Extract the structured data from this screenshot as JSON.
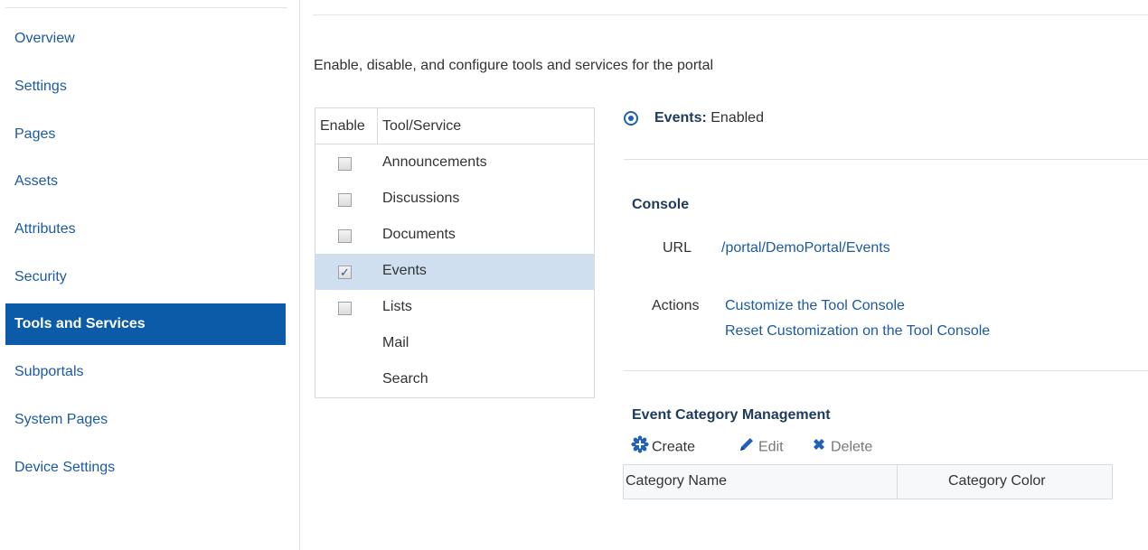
{
  "sidebar": {
    "items": [
      {
        "label": "Overview"
      },
      {
        "label": "Settings"
      },
      {
        "label": "Pages"
      },
      {
        "label": "Assets"
      },
      {
        "label": "Attributes"
      },
      {
        "label": "Security"
      },
      {
        "label": "Tools and Services",
        "active": true
      },
      {
        "label": "Subportals"
      },
      {
        "label": "System Pages"
      },
      {
        "label": "Device Settings"
      }
    ]
  },
  "main": {
    "description": "Enable, disable, and configure tools and services for the portal",
    "tools_table": {
      "headers": [
        "Enable",
        "Tool/Service"
      ],
      "rows": [
        {
          "label": "Announcements",
          "has_checkbox": true,
          "checked": false
        },
        {
          "label": "Discussions",
          "has_checkbox": true,
          "checked": false
        },
        {
          "label": "Documents",
          "has_checkbox": true,
          "checked": false
        },
        {
          "label": "Events",
          "has_checkbox": true,
          "checked": true,
          "selected": true
        },
        {
          "label": "Lists",
          "has_checkbox": true,
          "checked": false
        },
        {
          "label": "Mail",
          "has_checkbox": false
        },
        {
          "label": "Search",
          "has_checkbox": false
        }
      ]
    },
    "detail": {
      "tool_name": "Events:",
      "status": "Enabled",
      "console_title": "Console",
      "url_label": "URL",
      "url_value": "/portal/DemoPortal/Events",
      "actions_label": "Actions",
      "actions": [
        "Customize the Tool Console",
        "Reset Customization on the Tool Console"
      ],
      "category_management": {
        "title": "Event Category Management",
        "toolbar": {
          "create": "Create",
          "edit": "Edit",
          "delete": "Delete"
        },
        "columns": [
          "Category Name",
          "Category Color"
        ]
      }
    }
  },
  "colors": {
    "accent": "#0b5ba8",
    "link": "#1c5aa6",
    "selected_row": "#cfdff0",
    "heading": "#1e3a5c"
  }
}
